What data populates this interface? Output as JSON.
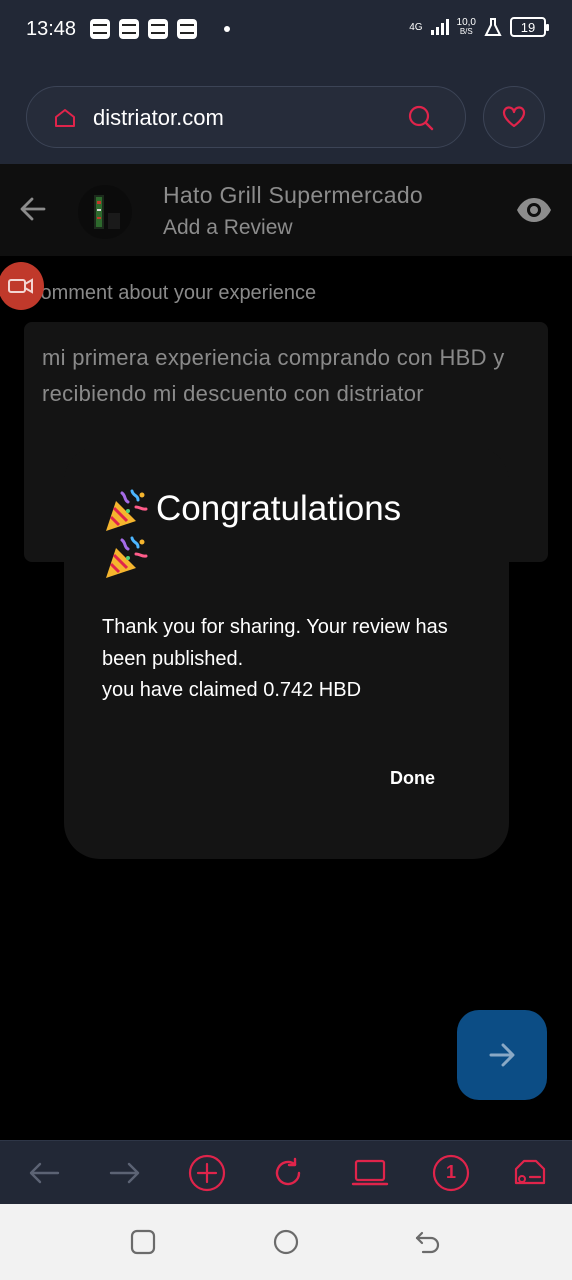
{
  "status_bar": {
    "time": "13:48",
    "network_type": "4G",
    "speed_value": "10,0",
    "speed_unit": "B/S",
    "battery": "19"
  },
  "browser": {
    "url": "distriator.com",
    "accent_color": "#e0244b"
  },
  "header": {
    "store_name": "Hato Grill Supermercado",
    "subtitle": "Add a Review"
  },
  "review": {
    "label": "Comment about your experience",
    "text": "mi primera experiencia comprando con HBD y recibiendo mi descuento con distriator"
  },
  "dialog": {
    "title": "Congratulations",
    "message_line1": "Thank you for sharing. Your review has been published.",
    "message_line2": "you have claimed 0.742 HBD",
    "done_label": "Done"
  },
  "toolbar": {
    "tab_count": "1"
  }
}
